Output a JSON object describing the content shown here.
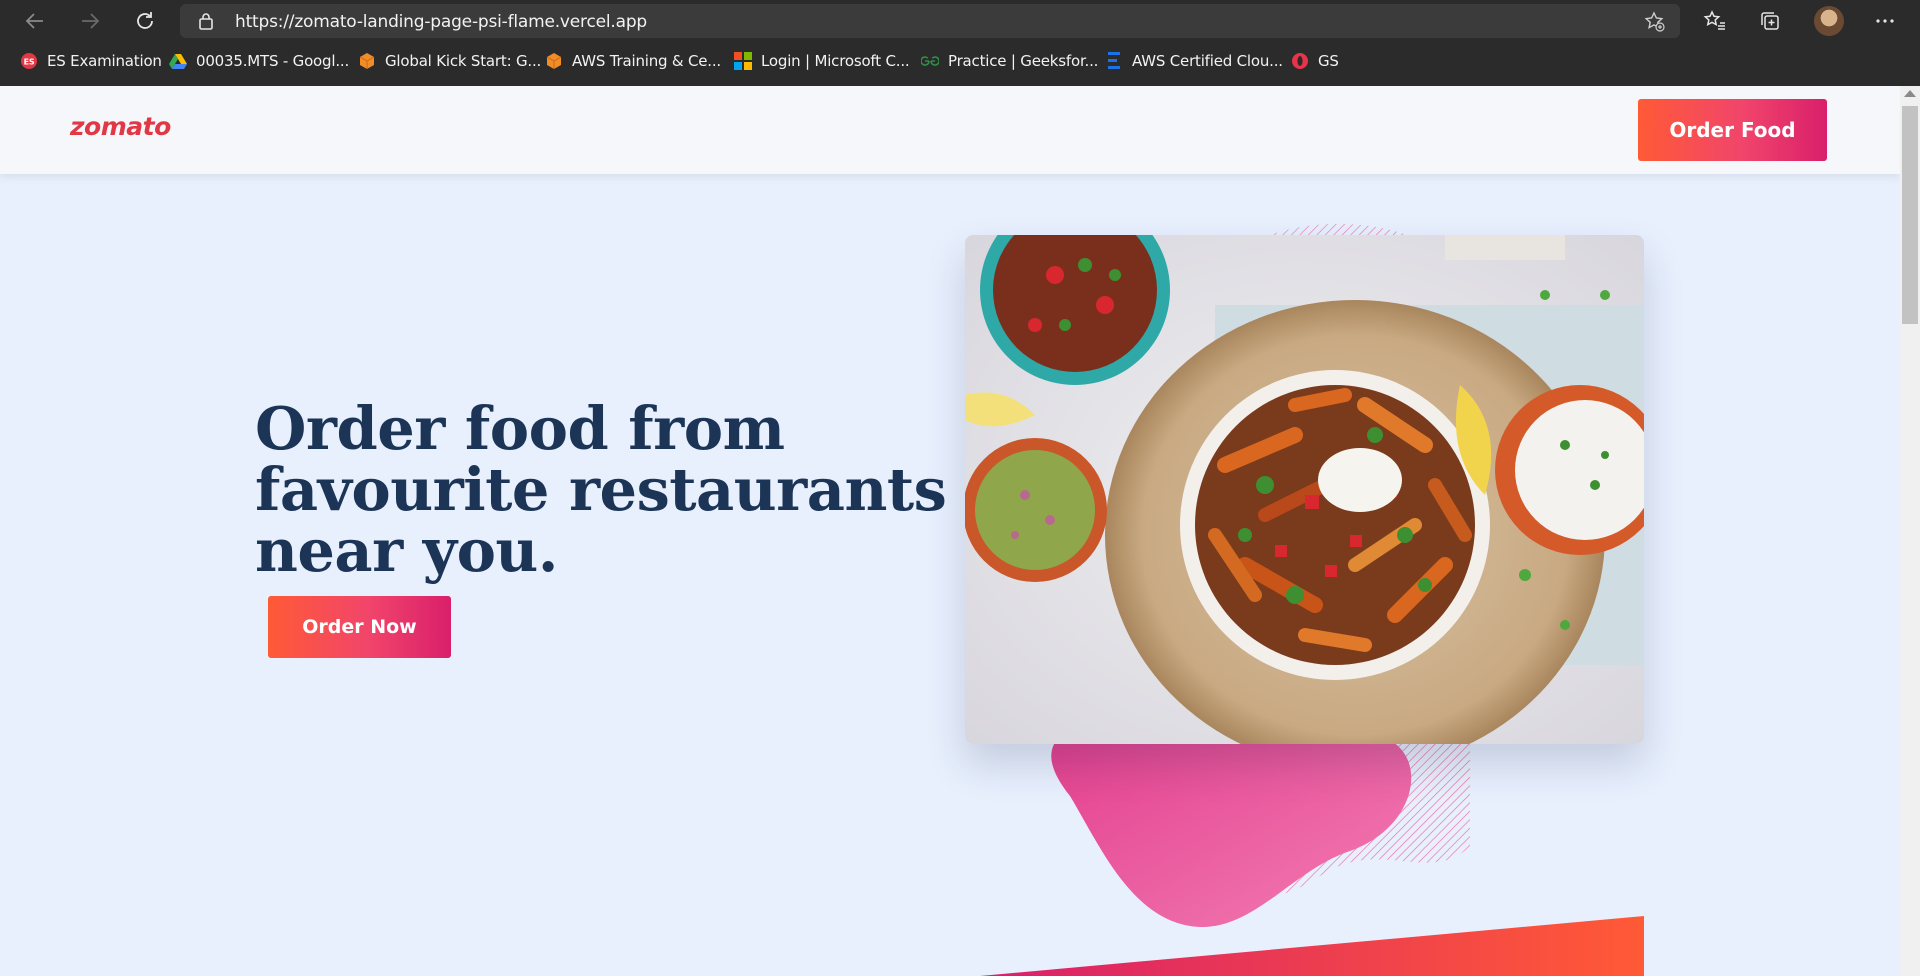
{
  "browser": {
    "url": "https://zomato-landing-page-psi-flame.vercel.app",
    "bookmarks": [
      {
        "label": "ES Examination",
        "icon": "es-exam-icon",
        "color": "#e23744"
      },
      {
        "label": "00035.MTS - Googl...",
        "icon": "google-drive-icon",
        "color": "#34a853"
      },
      {
        "label": "Global Kick Start: G...",
        "icon": "aws-cube-icon",
        "color": "#f28c28"
      },
      {
        "label": "AWS Training & Ce...",
        "icon": "aws-cube-icon",
        "color": "#f28c28"
      },
      {
        "label": "Login | Microsoft C...",
        "icon": "microsoft-icon",
        "color": "#00a4ef"
      },
      {
        "label": "Practice | Geeksfor...",
        "icon": "geeksforgeeks-icon",
        "color": "#2f8d46"
      },
      {
        "label": "AWS Certified Clou...",
        "icon": "stacked-bars-icon",
        "color": "#1a73e8"
      },
      {
        "label": "GS",
        "icon": "opera-icon",
        "color": "#e8334a"
      }
    ]
  },
  "site": {
    "logo": "zomato",
    "header_button": "Order Food",
    "headline": "Order food from favourite restaurants near you.",
    "cta_button": "Order Now"
  },
  "colors": {
    "brand_red": "#e23744",
    "gradient_start": "#ff5a36",
    "gradient_end": "#d91f6b",
    "headline": "#1c3557",
    "background": "#e8f0fe",
    "blob_pink": "#ee6aa7"
  }
}
